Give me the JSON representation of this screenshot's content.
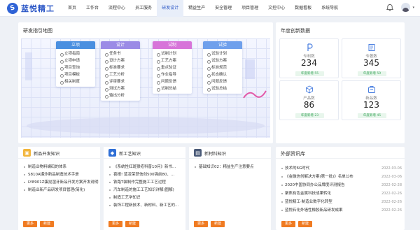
{
  "header": {
    "logo_text": "蓝悦精工",
    "nav": [
      "首页",
      "工作台",
      "流程中心",
      "员工服务",
      "研发设计",
      "精益生产",
      "安全管理",
      "项目管理",
      "文控中心",
      "数据看板",
      "系统导航"
    ],
    "active_nav": "研发设计"
  },
  "map": {
    "title": "研发指引地图",
    "columns": [
      {
        "head": "立项",
        "color": "#4a8fe0",
        "items": [
          "立项指南",
          "立项申请",
          "项目查询",
          "项目模板",
          "相关制度"
        ]
      },
      {
        "head": "设计",
        "color": "#9b8be6",
        "items": [
          "任务书",
          "设计方案",
          "标准要求",
          "工艺分析",
          "评审要求",
          "测试方案",
          "输出分析"
        ]
      },
      {
        "head": "试制",
        "color": "#d774d9",
        "items": [
          "试制计划",
          "工艺方案",
          "重点验证",
          "作业指导",
          "问题反馈",
          "试制总结"
        ]
      },
      {
        "head": "试验",
        "color": "#6fa0ec",
        "items": [
          "试验计划",
          "试验方案",
          "标准规范",
          "状态确认",
          "问题反馈",
          "试验总结"
        ]
      }
    ]
  },
  "stats": {
    "title": "年度创新数据",
    "items": [
      {
        "label": "专利数",
        "value": "234",
        "badge": "年度新增 55",
        "icon": "patent-icon"
      },
      {
        "label": "专著数",
        "value": "345",
        "badge": "年度新增 59",
        "icon": "book-icon"
      },
      {
        "label": "产品数",
        "value": "86",
        "badge": "年度新增 23",
        "icon": "product-icon"
      },
      {
        "label": "新品数",
        "value": "123",
        "badge": "年度新增 45",
        "icon": "new-product-icon"
      }
    ]
  },
  "knowledge": [
    {
      "title": "新品开发知识",
      "icon_color": "#f2b53b",
      "items": [
        "制造业物料编码的体系",
        "S810A爆炸新品制造技术手册",
        "LY8901Z蛋挞湿牙新品开发方案开发说明",
        "制造业新产品研发项目管理(简化)"
      ]
    },
    {
      "title": "新工艺知识",
      "icon_color": "#2f6fd6",
      "items": [
        "《系统性红斑狼疮科普10问》新书...",
        "喜报! 蓝凌荣获信创500强前80、...",
        "铁路T装制作完整施工工艺过程",
        "汽车制造的施工工艺知识详解(图解)",
        "制造工艺学知识",
        "装饰工程新技术、新材料、新工艺的..."
      ]
    },
    {
      "title": "新材料知识",
      "icon_color": "#4a5a78",
      "items": [
        "基础知识02：精益生产注意要点"
      ]
    }
  ],
  "knowledge_buttons": {
    "more": "更多",
    "add": "新建"
  },
  "news": {
    "title": "外部资讯库",
    "items": [
      {
        "t": "技术的6G时代",
        "d": "2022-03-06"
      },
      {
        "t": "《金融信创解决方案(第一批)》名单公布",
        "d": "2022-03-06"
      },
      {
        "t": "2020中国协同办公品牌度评测报告",
        "d": "2022-02-28"
      },
      {
        "t": "聚焦有色金属科技成果转化",
        "d": "2022-02-26"
      },
      {
        "t": "蓝悦精工·制造业数字化转型",
        "d": "2022-02-26"
      },
      {
        "t": "蓝悦石化外墙性橡胶新品研发成果",
        "d": "2022-02-26"
      }
    ],
    "more": "更多",
    "add": "新建"
  }
}
